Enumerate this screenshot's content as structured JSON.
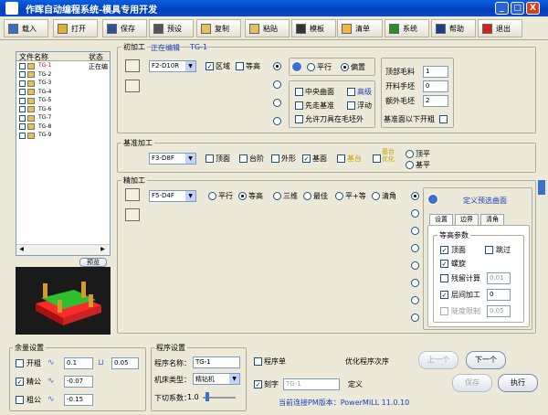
{
  "window": {
    "title": "作晖自动编程系统-模具专用开发",
    "min": "_",
    "max": "□",
    "close": "X"
  },
  "toolbar": [
    {
      "label": "载入",
      "icon": "load-icon",
      "color": "#3a6fc0"
    },
    {
      "label": "打开",
      "icon": "open-icon",
      "color": "#e0b030"
    },
    {
      "label": "保存",
      "icon": "save-icon",
      "color": "#2c4f99"
    },
    {
      "label": "预设",
      "icon": "preset-icon",
      "color": "#555555"
    },
    {
      "label": "复制",
      "icon": "copy-icon",
      "color": "#e4c060"
    },
    {
      "label": "粘贴",
      "icon": "paste-icon",
      "color": "#e4c060"
    },
    {
      "label": "模板",
      "icon": "template-icon",
      "color": "#333333"
    },
    {
      "label": "清单",
      "icon": "list-icon",
      "color": "#f2b640"
    },
    {
      "label": "系统",
      "icon": "system-icon",
      "color": "#2d8a2d"
    },
    {
      "label": "帮助",
      "icon": "help-icon",
      "color": "#1e3c8c"
    },
    {
      "label": "退出",
      "icon": "exit-icon",
      "color": "#cc2222"
    }
  ],
  "file_list": {
    "header_name": "文件名称",
    "header_status": "状态",
    "items": [
      {
        "name": "TG-1",
        "status": "正在编",
        "checked": false,
        "active": true
      },
      {
        "name": "TG-2",
        "status": "",
        "checked": false
      },
      {
        "name": "TG-3",
        "status": "",
        "checked": false
      },
      {
        "name": "TG-4",
        "status": "",
        "checked": false
      },
      {
        "name": "TG-5",
        "status": "",
        "checked": false
      },
      {
        "name": "TG-6",
        "status": "",
        "checked": false
      },
      {
        "name": "TG-7",
        "status": "",
        "checked": false
      },
      {
        "name": "TG-8",
        "status": "",
        "checked": false
      },
      {
        "name": "TG-9",
        "status": "",
        "checked": false
      }
    ],
    "preview_label": "预览"
  },
  "rough": {
    "title": "初加工",
    "status": "正在编辑",
    "file": "TG-1",
    "tool": "F2-D10R",
    "chk1": "区域",
    "chk2": "等高",
    "opt_parallel": "平行",
    "opt_offset": "偏置",
    "chk_center": "中央曲面",
    "chk_advance": "高级",
    "chk_first": "先走基准",
    "chk_float": "浮动",
    "chk_allow": "允许刀具在毛坯外",
    "top_stock_label": "顶部毛料",
    "top_stock": "1",
    "open_stock_label": "开料手坯",
    "open_stock": "0",
    "extra_label": "额外毛坯",
    "extra": "2",
    "below_label": "基准面以下开粗"
  },
  "datum": {
    "title": "基准加工",
    "tool": "F3-D8F",
    "items": [
      "顶面",
      "台阶",
      "外形",
      "基面",
      "基台"
    ],
    "checked": [
      false,
      false,
      false,
      true,
      false
    ],
    "chk_auto": "基台\n优化",
    "opt_top": "顶平",
    "opt_bottom": "基平"
  },
  "finish": {
    "title": "精加工",
    "tool": "F5-D4F",
    "options": [
      "平行",
      "等高",
      "三维",
      "最佳",
      "平+等",
      "清角"
    ],
    "selected": 1,
    "define_label": "定义预选曲面",
    "tabs": [
      "设置",
      "边界",
      "清角"
    ],
    "group": "等高参数",
    "chk_top": "顶面",
    "chk_skip": "跳过",
    "chk_spiral": "螺旋",
    "chk_flat": "残留计算",
    "flat_val": "0.01",
    "chk_layer": "层间加工",
    "layer_val": "0",
    "chk_steep": "陡度限制",
    "steep_val": "0.05"
  },
  "stock": {
    "title": "余量设置",
    "rows": [
      {
        "label": "开粗",
        "checked": false,
        "v1": "0.1",
        "v2": "0.05"
      },
      {
        "label": "精公",
        "checked": true,
        "v1": "-0.07"
      },
      {
        "label": "粗公",
        "checked": false,
        "v1": "-0.15"
      }
    ]
  },
  "program": {
    "title": "程序设置",
    "name_label": "程序名称：",
    "name": "TG-1",
    "machine_label": "机床类型：",
    "machine": "精钻机",
    "factor_label": "下切系数：",
    "factor": "1.0"
  },
  "misc": {
    "chk_list": "程序单",
    "optimize_label": "优化程序次序",
    "chk_engrave": "刻字",
    "engrave_val": "TG-1",
    "define": "定义",
    "version": "当前连接PM版本：PowerMILL 11.0.10",
    "btn_prev": "上一个",
    "btn_next": "下一个",
    "btn_save": "保存",
    "btn_run": "执行"
  }
}
